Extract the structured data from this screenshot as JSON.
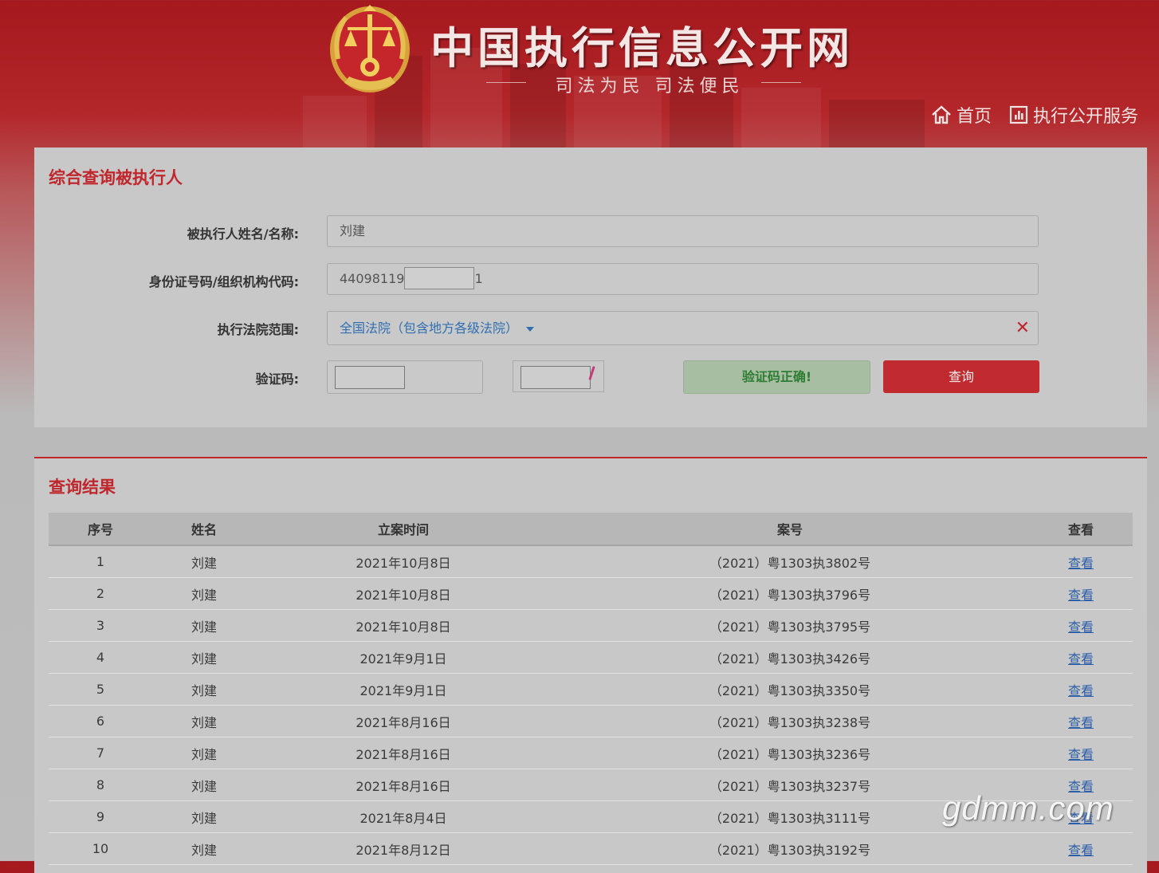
{
  "header": {
    "site_title": "中国执行信息公开网",
    "slogan": "司法为民  司法便民",
    "nav": [
      {
        "label": "首页",
        "icon": "home-icon"
      },
      {
        "label": "执行公开服务",
        "icon": "chart-icon"
      }
    ]
  },
  "search": {
    "title": "综合查询被执行人",
    "name_label": "被执行人姓名/名称:",
    "name_value": "刘建",
    "id_label": "身份证号码/组织机构代码:",
    "id_value_prefix": "44098119",
    "id_value_suffix": "1",
    "court_label": "执行法院范围:",
    "court_value": "全国法院（包含地方各级法院）",
    "captcha_label": "验证码:",
    "captcha_status": "验证码正确!",
    "query_button": "查询"
  },
  "results": {
    "title": "查询结果",
    "columns": [
      "序号",
      "姓名",
      "立案时间",
      "案号",
      "查看"
    ],
    "rows": [
      [
        "1",
        "刘建",
        "2021年10月8日",
        "（2021）粤1303执3802号",
        "查看"
      ],
      [
        "2",
        "刘建",
        "2021年10月8日",
        "（2021）粤1303执3796号",
        "查看"
      ],
      [
        "3",
        "刘建",
        "2021年10月8日",
        "（2021）粤1303执3795号",
        "查看"
      ],
      [
        "4",
        "刘建",
        "2021年9月1日",
        "（2021）粤1303执3426号",
        "查看"
      ],
      [
        "5",
        "刘建",
        "2021年9月1日",
        "（2021）粤1303执3350号",
        "查看"
      ],
      [
        "6",
        "刘建",
        "2021年8月16日",
        "（2021）粤1303执3238号",
        "查看"
      ],
      [
        "7",
        "刘建",
        "2021年8月16日",
        "（2021）粤1303执3236号",
        "查看"
      ],
      [
        "8",
        "刘建",
        "2021年8月16日",
        "（2021）粤1303执3237号",
        "查看"
      ],
      [
        "9",
        "刘建",
        "2021年8月4日",
        "（2021）粤1303执3111号",
        "查看"
      ],
      [
        "10",
        "刘建",
        "2021年8月12日",
        "（2021）粤1303执3192号",
        "查看"
      ]
    ]
  },
  "watermark": "gdmm.com",
  "colors": {
    "brand_red": "#c0272d",
    "link_blue": "#2d5ea8",
    "ok_green": "#2e7d32"
  }
}
